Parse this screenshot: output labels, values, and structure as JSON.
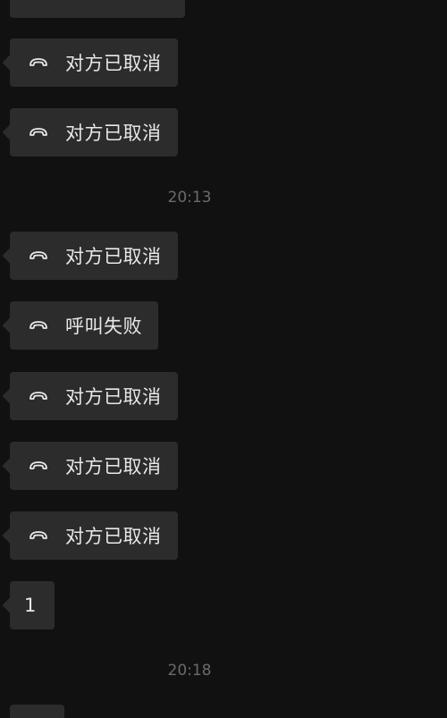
{
  "messages": {
    "m1": {
      "text": "对方已取消",
      "icon": "hangup-icon"
    },
    "m2": {
      "text": "对方已取消",
      "icon": "hangup-icon"
    },
    "m3": {
      "text": "对方已取消",
      "icon": "hangup-icon"
    },
    "m4": {
      "text": "呼叫失败",
      "icon": "hangup-icon"
    },
    "m5": {
      "text": "对方已取消",
      "icon": "hangup-icon"
    },
    "m6": {
      "text": "对方已取消",
      "icon": "hangup-icon"
    },
    "m7": {
      "text": "对方已取消",
      "icon": "hangup-icon"
    },
    "m8": {
      "text": "1"
    }
  },
  "timestamps": {
    "t1": "20:13",
    "t2": "20:18"
  },
  "colors": {
    "background": "#111111",
    "bubble": "#2c2c2c",
    "text": "#e9e9e9",
    "timestamp": "#6b6b6b"
  }
}
